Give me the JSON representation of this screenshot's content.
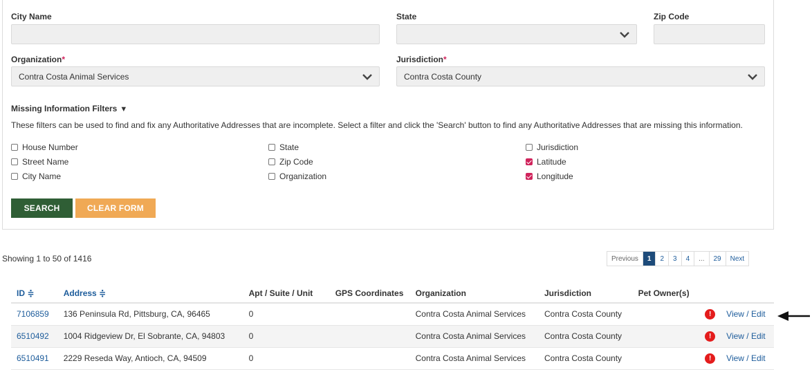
{
  "form": {
    "city_label": "City Name",
    "city_value": "",
    "state_label": "State",
    "state_value": "",
    "zip_label": "Zip Code",
    "zip_value": "",
    "organization_label": "Organization",
    "organization_value": "Contra Costa Animal Services",
    "jurisdiction_label": "Jurisdiction",
    "jurisdiction_value": "Contra Costa County",
    "required_mark": "*"
  },
  "filters": {
    "title": "Missing Information Filters",
    "toggle_glyph": "▼",
    "description": "These filters can be used to find and fix any Authoritative Addresses that are incomplete. Select a filter and click the 'Search' button to find any Authoritative Addresses that are missing this information.",
    "options": [
      {
        "label": "House Number",
        "checked": false
      },
      {
        "label": "Street Name",
        "checked": false
      },
      {
        "label": "City Name",
        "checked": false
      },
      {
        "label": "State",
        "checked": false
      },
      {
        "label": "Zip Code",
        "checked": false
      },
      {
        "label": "Organization",
        "checked": false
      },
      {
        "label": "Jurisdiction",
        "checked": false
      },
      {
        "label": "Latitude",
        "checked": true
      },
      {
        "label": "Longitude",
        "checked": true
      }
    ]
  },
  "buttons": {
    "search": "SEARCH",
    "clear": "CLEAR FORM"
  },
  "results": {
    "showing": "Showing 1 to 50 of 1416"
  },
  "pager": {
    "previous": "Previous",
    "pages": [
      "1",
      "2",
      "3",
      "4",
      "...",
      "29"
    ],
    "active_page": "1",
    "next": "Next"
  },
  "table": {
    "headers": {
      "id": "ID ≑",
      "address": "Address ≑",
      "unit": "Apt / Suite / Unit",
      "gps": "GPS Coordinates",
      "organization": "Organization",
      "jurisdiction": "Jurisdiction",
      "owners": "Pet Owner(s)"
    },
    "rows": [
      {
        "id": "7106859",
        "address": "136 Peninsula Rd, Pittsburg, CA, 96465",
        "unit": "0",
        "gps": "",
        "organization": "Contra Costa Animal Services",
        "jurisdiction": "Contra Costa County",
        "owners": "",
        "alert": "!",
        "action": "View / Edit"
      },
      {
        "id": "6510492",
        "address": "1004 Ridgeview Dr, El Sobrante, CA, 94803",
        "unit": "0",
        "gps": "",
        "organization": "Contra Costa Animal Services",
        "jurisdiction": "Contra Costa County",
        "owners": "",
        "alert": "!",
        "action": "View / Edit"
      },
      {
        "id": "6510491",
        "address": "2229 Reseda Way, Antioch, CA, 94509",
        "unit": "0",
        "gps": "",
        "organization": "Contra Costa Animal Services",
        "jurisdiction": "Contra Costa County",
        "owners": "",
        "alert": "!",
        "action": "View / Edit"
      }
    ]
  },
  "colors": {
    "required": "#d0245c",
    "link": "#1d5c9b",
    "search_button": "#2f5e35",
    "clear_button": "#f0a955",
    "alert": "#e41c1c",
    "active_page": "#1d4b7a"
  },
  "icons": {
    "dropdown": "chevron-down-icon",
    "alert": "exclamation-circle-icon",
    "pointer": "arrow-left-icon",
    "sort": "sort-icon"
  }
}
